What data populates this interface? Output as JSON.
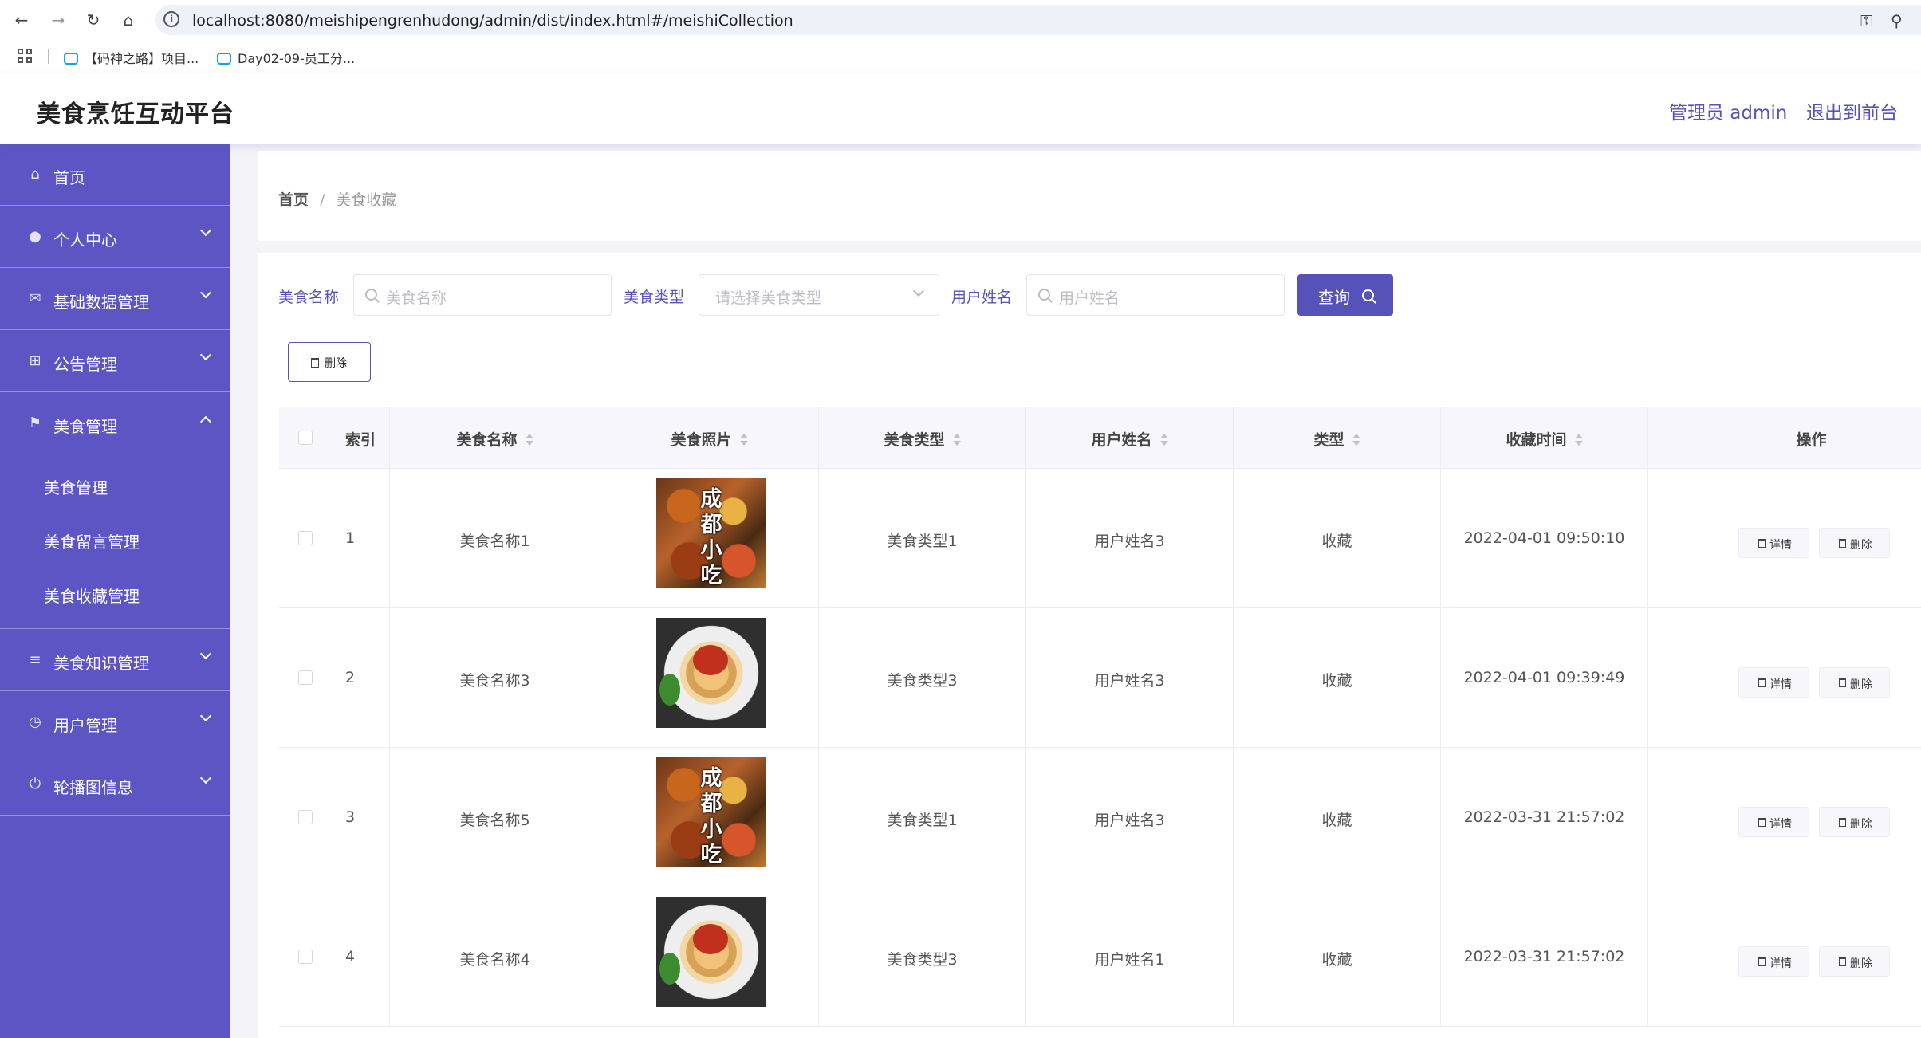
{
  "browser": {
    "url": "localhost:8080/meishipengrenhudong/admin/dist/index.html#/meishiCollection",
    "bookmarks": [
      "【码神之路】项目...",
      "Day02-09-员工分..."
    ]
  },
  "header": {
    "title": "美食烹饪互动平台",
    "admin_label": "管理员 admin",
    "exit_label": "退出到前台"
  },
  "sidebar": {
    "items": [
      {
        "label": "首页",
        "icon": "home-icon"
      },
      {
        "label": "个人中心",
        "icon": "user-icon"
      },
      {
        "label": "基础数据管理",
        "icon": "mail-icon"
      },
      {
        "label": "公告管理",
        "icon": "crop-icon"
      },
      {
        "label": "美食管理",
        "icon": "flag-icon"
      },
      {
        "label": "美食知识管理",
        "icon": "sliders-icon"
      },
      {
        "label": "用户管理",
        "icon": "clock-icon"
      },
      {
        "label": "轮播图信息",
        "icon": "power-icon"
      }
    ],
    "submenu": [
      "美食管理",
      "美食留言管理",
      "美食收藏管理"
    ]
  },
  "breadcrumb": {
    "home": "首页",
    "sep": "/",
    "current": "美食收藏"
  },
  "filters": {
    "name_label": "美食名称",
    "name_placeholder": "美食名称",
    "type_label": "美食类型",
    "type_placeholder": "请选择美食类型",
    "user_label": "用户姓名",
    "user_placeholder": "用户姓名",
    "query_label": "查询"
  },
  "toolbar": {
    "delete_label": "删除"
  },
  "table": {
    "columns": [
      "索引",
      "美食名称",
      "美食照片",
      "美食类型",
      "用户姓名",
      "类型",
      "收藏时间",
      "操作"
    ],
    "rows": [
      {
        "index": "1",
        "name": "美食名称1",
        "image": "a",
        "image_text": [
          "成",
          "都",
          "小",
          "吃"
        ],
        "type": "美食类型1",
        "user": "用户姓名3",
        "kind": "收藏",
        "time": "2022-04-01 09:50:10"
      },
      {
        "index": "2",
        "name": "美食名称3",
        "image": "b",
        "type": "美食类型3",
        "user": "用户姓名3",
        "kind": "收藏",
        "time": "2022-04-01 09:39:49"
      },
      {
        "index": "3",
        "name": "美食名称5",
        "image": "a",
        "image_text": [
          "成",
          "都",
          "小",
          "吃"
        ],
        "type": "美食类型1",
        "user": "用户姓名3",
        "kind": "收藏",
        "time": "2022-03-31 21:57:02"
      },
      {
        "index": "4",
        "name": "美食名称4",
        "image": "b",
        "type": "美食类型3",
        "user": "用户姓名1",
        "kind": "收藏",
        "time": "2022-03-31 21:57:02"
      }
    ],
    "detail_label": "详情",
    "delete_label": "删除"
  }
}
